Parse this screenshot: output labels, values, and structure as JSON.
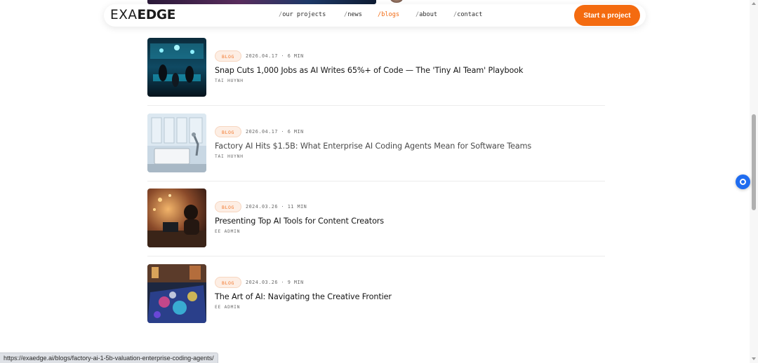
{
  "nav": {
    "logo_light": "EXA",
    "logo_bold": "EDGE",
    "links": [
      {
        "slash": "/",
        "label": "our projects"
      },
      {
        "slash": "/",
        "label": "news"
      },
      {
        "slash": "/",
        "label": "blogs"
      },
      {
        "slash": "/",
        "label": "about"
      },
      {
        "slash": "/",
        "label": "contact"
      }
    ],
    "active_link": "blogs",
    "cta_label": "Start a project"
  },
  "posts": [
    {
      "badge": "BLOG",
      "meta": "2026.04.17 · 6 MIN",
      "title": "Snap Cuts 1,000 Jobs as AI Writes 65%+ of Code — The 'Tiny AI Team' Playbook",
      "author": "TAI HUYNH"
    },
    {
      "badge": "BLOG",
      "meta": "2026.04.17 · 6 MIN",
      "title": "Factory AI Hits $1.5B: What Enterprise AI Coding Agents Mean for Software Teams",
      "author": "TAI HUYNH"
    },
    {
      "badge": "BLOG",
      "meta": "2024.03.26 · 11 MIN",
      "title": "Presenting Top AI Tools for Content Creators",
      "author": "EE ADMIN"
    },
    {
      "badge": "BLOG",
      "meta": "2024.03.26 · 9 MIN",
      "title": "The Art of AI: Navigating the Creative Frontier",
      "author": "EE ADMIN"
    }
  ],
  "status_bar": {
    "url": "https://exaedge.ai/blogs/factory-ai-1-5b-valuation-enterprise-coding-agents/"
  },
  "colors": {
    "accent": "#f46b10",
    "badge_bg": "#fdeee4",
    "chat_widget": "#1f6cf0"
  },
  "icons": {
    "chat_widget": "chat-bubble-icon"
  }
}
